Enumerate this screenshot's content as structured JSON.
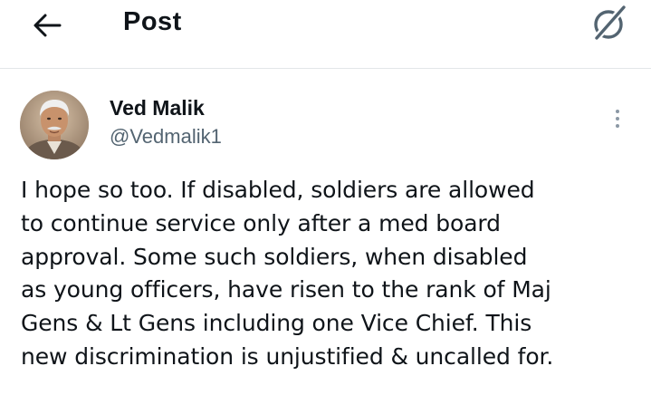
{
  "header": {
    "back_icon": "arrow-left-icon",
    "title": "Post",
    "grok_icon": "grok-icon"
  },
  "post": {
    "author": {
      "name": "Ved Malik",
      "handle": "@Vedmalik1",
      "avatar_icon": "user-avatar"
    },
    "more_icon": "more-vertical-icon",
    "text": "I hope so too. If disabled, soldiers are allowed\nto continue service only after a med board\napproval. Some such soldiers, when disabled\nas young officers, have risen to the rank of Maj\nGens & Lt Gens including one Vice Chief. This\nnew discrimination is unjustified & uncalled for."
  },
  "colors": {
    "text": "#0f1419",
    "secondary_text": "#536471",
    "divider": "#e3e6e8",
    "icon_gray": "#8b98a5"
  }
}
